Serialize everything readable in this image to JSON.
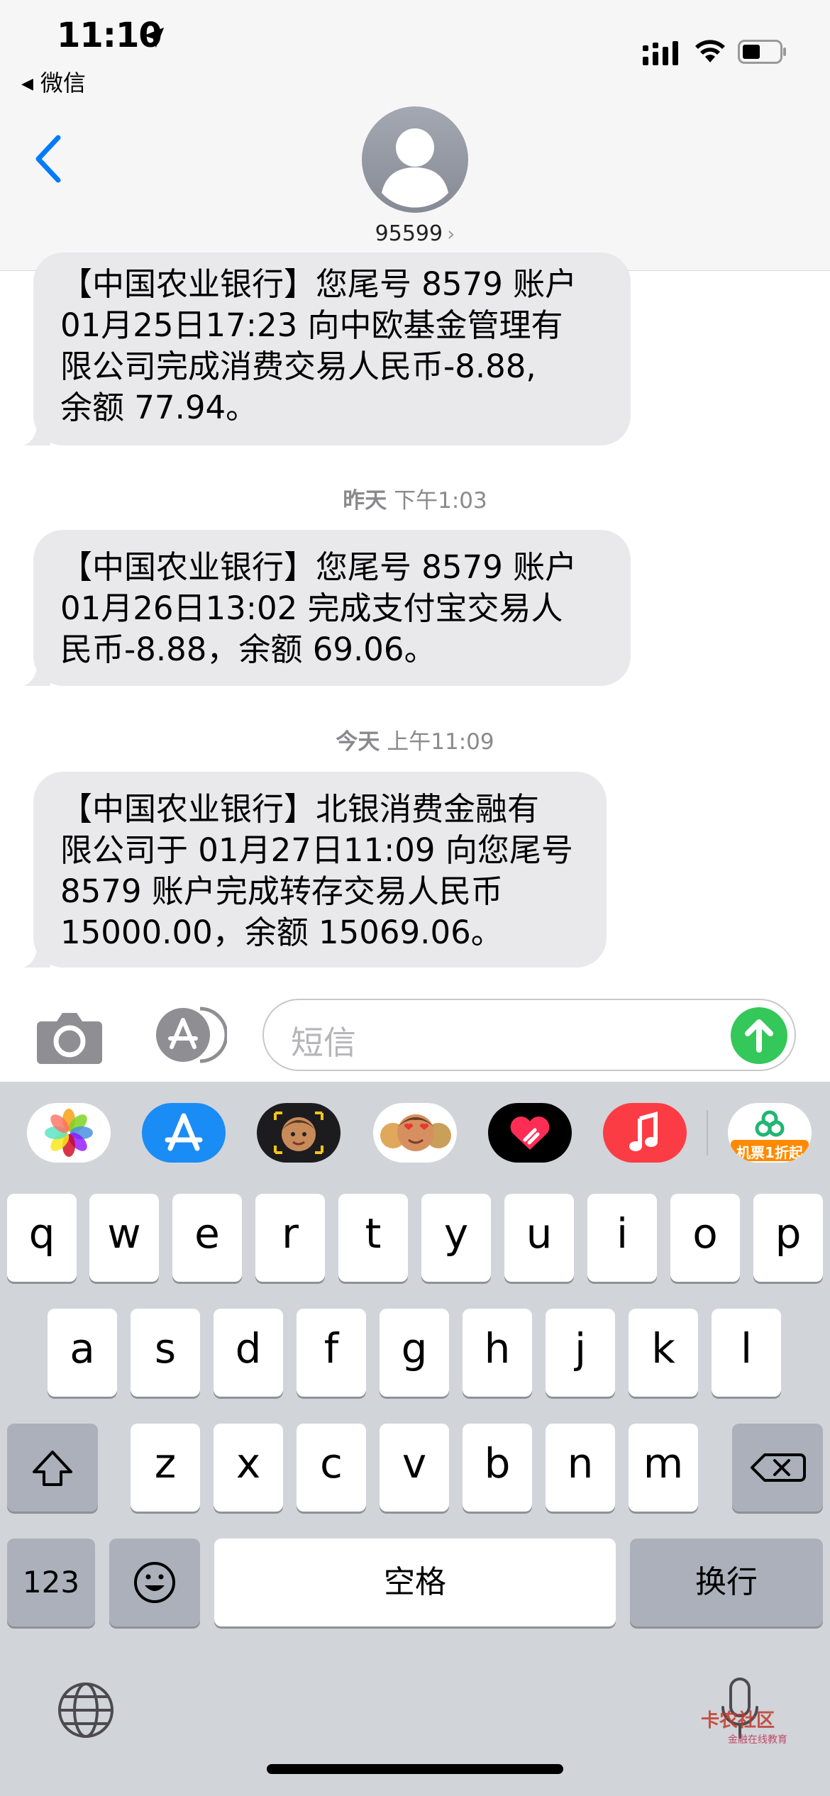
{
  "status_bar": {
    "time": "11:10",
    "back_app": "微信"
  },
  "header": {
    "contact": "95599",
    "chevron": "›"
  },
  "messages": [
    {
      "text": "【中国农业银行】您尾号 8579 账户\n01月25日17:23 向中欧基金管理有\n限公司完成消费交易人民币-8.88,\n余额 77.94。"
    },
    {
      "text": "【中国农业银行】您尾号 8579 账户\n01月26日13:02 完成支付宝交易人\n民币-8.88，余额 69.06。"
    },
    {
      "text": "【中国农业银行】北银消费金融有\n限公司于 01月27日11:09 向您尾号\n8579 账户完成转存交易人民币\n15000.00，余额 15069.06。"
    }
  ],
  "timestamps": [
    {
      "day": "昨天",
      "time": "下午1:03"
    },
    {
      "day": "今天",
      "time": "上午11:09"
    }
  ],
  "input": {
    "placeholder": "短信"
  },
  "app_strip": {
    "apps": [
      "photos-icon",
      "app-store-icon",
      "memoji-icon",
      "animoji-icon",
      "digital-touch-icon",
      "music-icon",
      "ticket-app-icon"
    ],
    "ticket_label": "机票1折起"
  },
  "keyboard": {
    "row1": [
      "q",
      "w",
      "e",
      "r",
      "t",
      "y",
      "u",
      "i",
      "o",
      "p"
    ],
    "row2": [
      "a",
      "s",
      "d",
      "f",
      "g",
      "h",
      "j",
      "k",
      "l"
    ],
    "row3": [
      "z",
      "x",
      "c",
      "v",
      "b",
      "n",
      "m"
    ],
    "num_key": "123",
    "space_key": "空格",
    "return_key": "换行"
  },
  "watermark": {
    "title": "卡农社区",
    "subtitle": "金融在线教育"
  },
  "colors": {
    "accent": "#007aff",
    "bubble_gray": "#e9e9eb",
    "send_green": "#34c759",
    "keyboard_bg": "#d1d4d9"
  }
}
